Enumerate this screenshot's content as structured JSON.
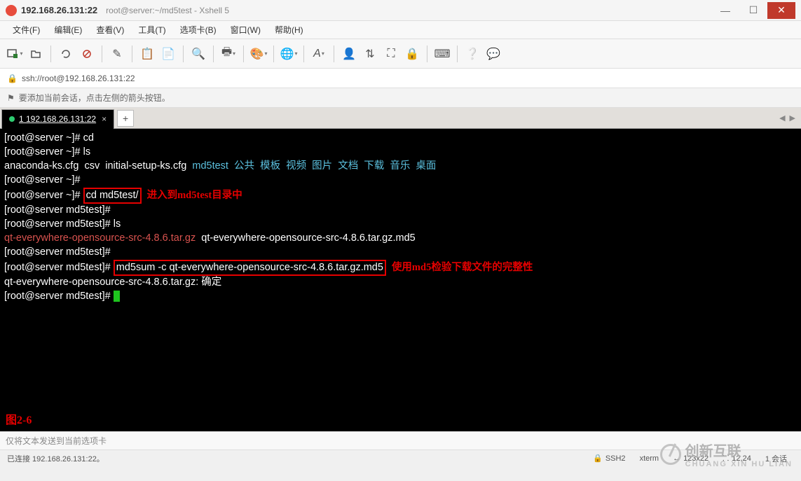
{
  "title": {
    "main": "192.168.26.131:22",
    "sub": "root@server:~/md5test - Xshell 5"
  },
  "menus": [
    "文件(F)",
    "编辑(E)",
    "查看(V)",
    "工具(T)",
    "选项卡(B)",
    "窗口(W)",
    "帮助(H)"
  ],
  "address": "ssh://root@192.168.26.131:22",
  "infobar": "要添加当前会话，点击左侧的箭头按钮。",
  "tab": {
    "label": "1 192.168.26.131:22"
  },
  "term": {
    "l1_prompt": "[root@server ~]# ",
    "l1_cmd": "cd",
    "l2_prompt": "[root@server ~]# ",
    "l2_cmd": "ls",
    "l3_files": "anaconda-ks.cfg  csv  initial-setup-ks.cfg  ",
    "l3_blue": "md5test  公共  模板  视频  图片  文档  下载  音乐  桌面",
    "l4": "[root@server ~]#",
    "l5_prompt": "[root@server ~]# ",
    "l5_box": "cd md5test/",
    "l5_anno": "进入到md5test目录中",
    "l6": "[root@server md5test]#",
    "l7_prompt": "[root@server md5test]# ",
    "l7_cmd": "ls",
    "l8_red": "qt-everywhere-opensource-src-4.8.6.tar.gz",
    "l8_rest": "  qt-everywhere-opensource-src-4.8.6.tar.gz.md5",
    "l9": "[root@server md5test]#",
    "l10_prompt": "[root@server md5test]# ",
    "l10_box": "md5sum -c qt-everywhere-opensource-src-4.8.6.tar.gz.md5",
    "l10_anno": "使用md5检验下载文件的完整性",
    "l11": "qt-everywhere-opensource-src-4.8.6.tar.gz: 确定",
    "l12": "[root@server md5test]# ",
    "fig": "图2-6"
  },
  "input_placeholder": "仅将文本发送到当前选项卡",
  "status": {
    "left": "已连接 192.168.26.131:22。",
    "ssh": "SSH2",
    "term": "xterm",
    "size": "123x22",
    "pos": "12,24",
    "sess": "1 会话"
  },
  "watermark": {
    "cn": "创新互联",
    "py": "CHUANG XIN HU LIAN"
  }
}
